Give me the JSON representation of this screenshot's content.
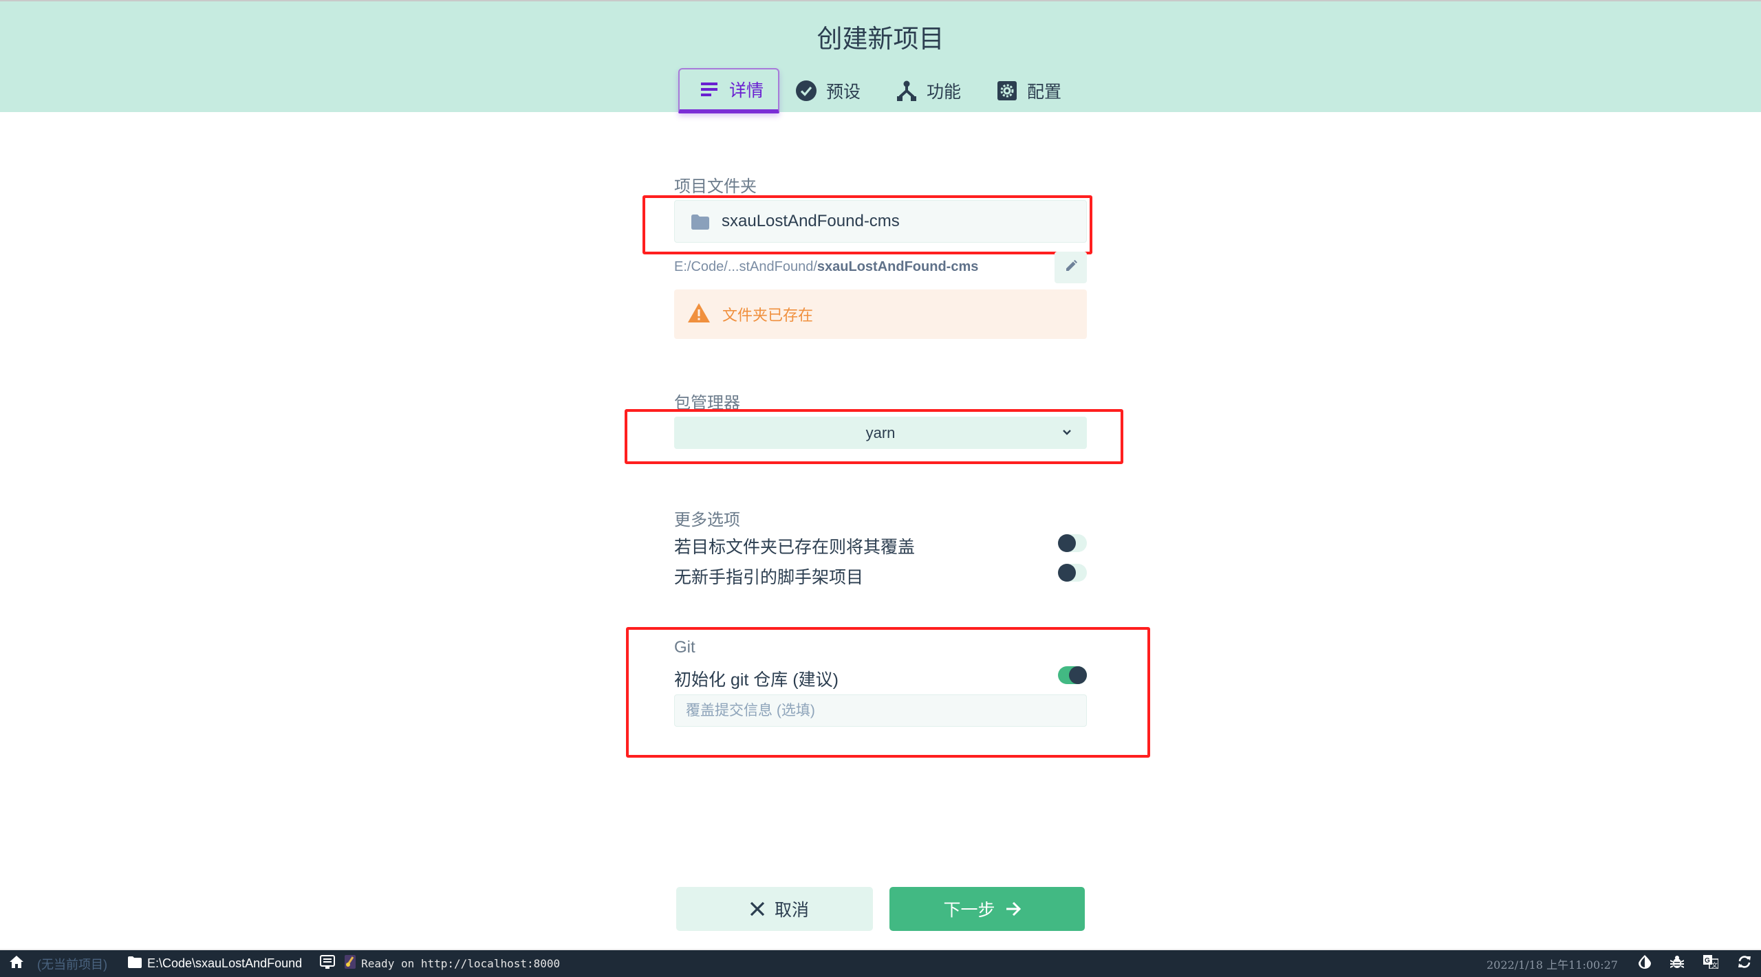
{
  "header": {
    "title": "创建新项目",
    "tabs": [
      {
        "label": "详情",
        "icon": "list-icon",
        "active": true
      },
      {
        "label": "预设",
        "icon": "check-circle-icon",
        "active": false
      },
      {
        "label": "功能",
        "icon": "fork-icon",
        "active": false
      },
      {
        "label": "配置",
        "icon": "gear-icon",
        "active": false
      }
    ]
  },
  "form": {
    "folder": {
      "label": "项目文件夹",
      "value": "sxauLostAndFound-cms",
      "path_prefix": "E:/Code/...stAndFound/",
      "path_name": "sxauLostAndFound-cms",
      "warning": "文件夹已存在"
    },
    "package_manager": {
      "label": "包管理器",
      "value": "yarn"
    },
    "more_options": {
      "label": "更多选项",
      "items": [
        {
          "label": "若目标文件夹已存在则将其覆盖",
          "enabled": false
        },
        {
          "label": "无新手指引的脚手架项目",
          "enabled": false
        }
      ]
    },
    "git": {
      "label": "Git",
      "init_label": "初始化 git 仓库 (建议)",
      "init_enabled": true,
      "commit_placeholder": "覆盖提交信息 (选填)",
      "commit_value": ""
    }
  },
  "actions": {
    "cancel_label": "取消",
    "next_label": "下一步"
  },
  "statusbar": {
    "no_project": "(无当前项目)",
    "cwd": "E:\\Code\\sxauLostAndFound",
    "log": "Ready on http://localhost:8000",
    "datetime": "2022/1/18 上午11:00:27"
  },
  "colors": {
    "header_bg": "#c6ebe0",
    "accent_purple": "#7b2ed6",
    "primary_green": "#42b983",
    "warning_orange": "#f0903e",
    "statusbar_bg": "#1e2a37",
    "highlight_red": "#ff1f1f"
  }
}
